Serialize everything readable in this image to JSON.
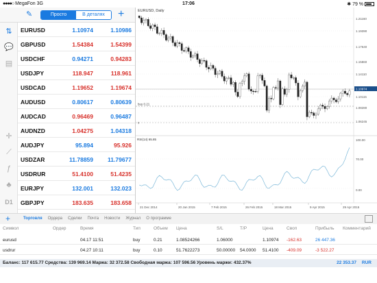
{
  "status": {
    "carrier": "MegaFon",
    "network": "3G",
    "time": "17:06",
    "battery": "79 %"
  },
  "toolbar": {
    "tab_simple": "Просто",
    "tab_details": "В деталях"
  },
  "quotes": [
    {
      "symbol": "EURUSD",
      "bid": "1.10974",
      "ask": "1.10986",
      "dir": "up"
    },
    {
      "symbol": "GBPUSD",
      "bid": "1.54384",
      "ask": "1.54399",
      "dir": "down"
    },
    {
      "symbol": "USDCHF",
      "bid": "0.94271",
      "ask": "0.94283",
      "dir": "mixed"
    },
    {
      "symbol": "USDJPY",
      "bid": "118.947",
      "ask": "118.961",
      "dir": "down"
    },
    {
      "symbol": "USDCAD",
      "bid": "1.19652",
      "ask": "1.19674",
      "dir": "down"
    },
    {
      "symbol": "AUDUSD",
      "bid": "0.80617",
      "ask": "0.80639",
      "dir": "up"
    },
    {
      "symbol": "AUDCAD",
      "bid": "0.96469",
      "ask": "0.96487",
      "dir": "mixed"
    },
    {
      "symbol": "AUDNZD",
      "bid": "1.04275",
      "ask": "1.04318",
      "dir": "mixed"
    },
    {
      "symbol": "AUDJPY",
      "bid": "95.894",
      "ask": "95.926",
      "dir": "mixed"
    },
    {
      "symbol": "USDZAR",
      "bid": "11.78859",
      "ask": "11.79677",
      "dir": "up"
    },
    {
      "symbol": "USDRUR",
      "bid": "51.4100",
      "ask": "51.4235",
      "dir": "down"
    },
    {
      "symbol": "EURJPY",
      "bid": "132.001",
      "ask": "132.023",
      "dir": "up"
    },
    {
      "symbol": "GBPJPY",
      "bid": "183.635",
      "ask": "183.658",
      "dir": "down"
    }
  ],
  "chart": {
    "title": "EURUSD, Daily",
    "buy_label": "buy 0.21",
    "s_label": "s",
    "rsi_label": "RSI(14) 65.85",
    "price_ticks": [
      "1.21160",
      "1.19390",
      "1.17640",
      "1.15860",
      "1.14110",
      "1.12650",
      "1.10974",
      "1.10115",
      "1.08280",
      "1.06245"
    ],
    "rsi_ticks": [
      "100.00",
      "70.00",
      "0.00"
    ],
    "date_ticks": [
      "21 Dec 2014",
      "20 Jan 2015",
      "7 Feb 2015",
      "26 Feb 2015",
      "18 Mar 2015",
      "9 Apr 2015",
      "29 Apr 2015"
    ],
    "colors": {
      "candle": "#222222",
      "rsi": "#7ab7d8",
      "grid": "#d8d8d8",
      "current": "#1a4e8a"
    }
  },
  "bottom": {
    "tabs": [
      "Торговля",
      "Ордера",
      "Сделки",
      "Почта",
      "Новости",
      "Журнал",
      "О программе"
    ],
    "active_tab": "Торговля"
  },
  "trade": {
    "headers": [
      "Символ",
      "Ордер",
      "Время",
      "Тип",
      "Объем",
      "Цена",
      "S/L",
      "T/P",
      "Цена",
      "Своп",
      "Прибыль",
      "Комментарий"
    ],
    "rows": [
      {
        "symbol": "eurusd",
        "order": "",
        "time": "04.17 11:51",
        "type": "buy",
        "volume": "0.21",
        "price": "1.08524266",
        "sl": "1.06000",
        "tp": "",
        "price_now": "1.10974",
        "swap": "-162.63",
        "profit": "26 447.36",
        "comment": ""
      },
      {
        "symbol": "usdrur",
        "order": "",
        "time": "04.27 10:11",
        "type": "buy",
        "volume": "0.10",
        "price": "51.7622273",
        "sl": "50.00000",
        "tp": "54.0000",
        "price_now": "51.4100",
        "swap": "-409.09",
        "profit": "-3 522.27",
        "comment": ""
      }
    ],
    "balance_line": "Баланс: 117 615.77 Средства: 139 969.14 Маржа: 32 372.58 Свободная маржа: 107 596.56 Уровень маржи: 432.37%",
    "total_profit": "22 353.37",
    "currency": "RUR"
  }
}
